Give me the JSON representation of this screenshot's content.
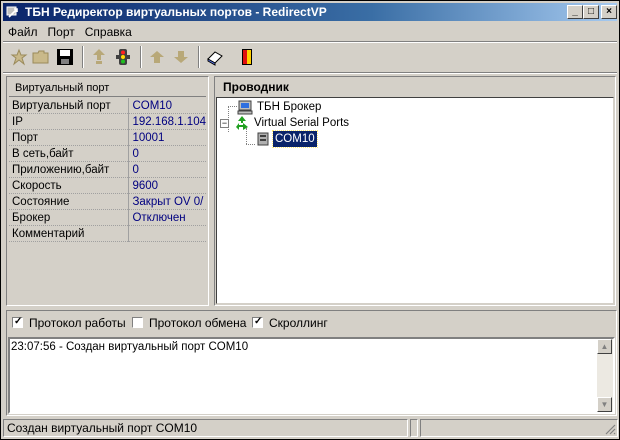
{
  "window": {
    "title": "ТБН Редиректор виртуальных портов - RedirectVP",
    "icon": "redirect-app-icon",
    "controls": {
      "minimize": "_",
      "maximize": "□",
      "close": "×"
    }
  },
  "menu": [
    "Файл",
    "Порт",
    "Справка"
  ],
  "toolbar": {
    "buttons": [
      {
        "icon": "new-port-icon",
        "enabled": false
      },
      {
        "icon": "open-folder-icon",
        "enabled": false
      },
      {
        "icon": "save-icon",
        "enabled": true
      },
      {
        "icon": "connect-icon",
        "enabled": false
      },
      {
        "icon": "traffic-light-icon",
        "enabled": true
      },
      {
        "icon": "port-up-icon",
        "enabled": false
      },
      {
        "icon": "port-down-icon",
        "enabled": false
      },
      {
        "icon": "eraser-icon",
        "enabled": true
      },
      {
        "icon": "exit-door-icon",
        "enabled": true
      }
    ]
  },
  "properties": {
    "header": "Виртуальный порт",
    "rows": [
      {
        "name": "Виртуальный порт",
        "value": "COM10"
      },
      {
        "name": "IP",
        "value": "192.168.1.104"
      },
      {
        "name": "Порт",
        "value": "10001"
      },
      {
        "name": "В сеть,байт",
        "value": "0"
      },
      {
        "name": "Приложению,байт",
        "value": "0"
      },
      {
        "name": "Скорость",
        "value": " 9600"
      },
      {
        "name": "Состояние",
        "value": "Закрыт  OV 0/"
      },
      {
        "name": "Брокер",
        "value": "Отключен"
      },
      {
        "name": "Комментарий",
        "value": ""
      }
    ]
  },
  "explorer": {
    "header": "Проводник",
    "nodes": [
      {
        "label": "ТБН Брокер",
        "icon": "computer-icon"
      },
      {
        "label": "Virtual Serial Ports",
        "icon": "recycle-ports-icon",
        "expander": "⊟"
      },
      {
        "label": "COM10",
        "icon": "serial-port-icon",
        "selected": true
      }
    ]
  },
  "options": [
    {
      "label": "Протокол работы",
      "checked": true
    },
    {
      "label": "Протокол обмена",
      "checked": false
    },
    {
      "label": "Скроллинг",
      "checked": true
    }
  ],
  "log": {
    "lines": [
      "23:07:56 - Создан виртуальный порт COM10"
    ],
    "scroll_up": "▲",
    "scroll_down": "▼"
  },
  "statusbar": {
    "text": "Создан виртуальный порт COM10"
  }
}
